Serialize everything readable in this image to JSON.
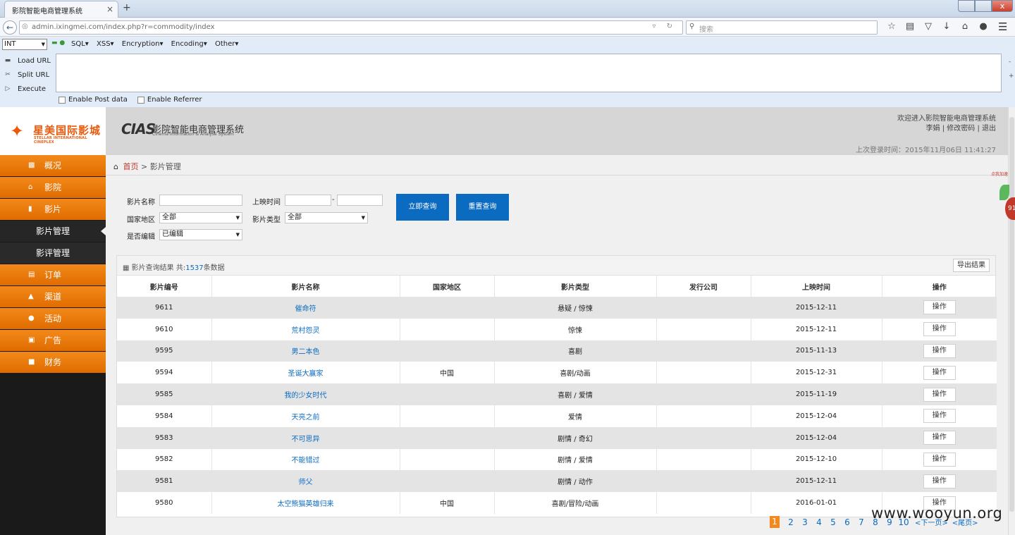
{
  "browser": {
    "tab_title": "影院智能电商管理系统",
    "tab_close": "×",
    "new_tab": "+",
    "url": "admin.ixingmei.com/index.php?r=commodity/index",
    "search_placeholder": "搜索",
    "window_close": "x"
  },
  "hackbar": {
    "type_select": "INT",
    "menus": [
      "SQL▾",
      "XSS▾",
      "Encryption▾",
      "Encoding▾",
      "Other▾"
    ],
    "actions": [
      "Load URL",
      "Split URL",
      "Execute"
    ],
    "checkbox_post": "Enable Post data",
    "checkbox_referrer": "Enable Referrer"
  },
  "header": {
    "logo_cn": "星美国际影城",
    "logo_en": "STELLAR INTERNATIONAL CINEPLEX",
    "brand_mark": "CIAS",
    "brand_title": "影院智能电商管理系统",
    "brand_sub": "Cinema Information & Analyse System",
    "welcome": "欢迎进入影院智能电商管理系统",
    "user_links": "李娟 | 修改密码 | 退出",
    "last_login": "上次登录时间：2015年11月06日 11:41:27"
  },
  "sidebar": {
    "items": [
      {
        "label": "概况",
        "icon": "chart-icon"
      },
      {
        "label": "影院",
        "icon": "home-icon"
      },
      {
        "label": "影片",
        "icon": "film-icon"
      }
    ],
    "sub_items": [
      {
        "label": "影片管理",
        "active": true
      },
      {
        "label": "影评管理",
        "active": false
      }
    ],
    "more_items": [
      {
        "label": "订单",
        "icon": "order-icon"
      },
      {
        "label": "渠道",
        "icon": "channel-icon"
      },
      {
        "label": "活动",
        "icon": "activity-icon"
      },
      {
        "label": "广告",
        "icon": "ad-icon"
      },
      {
        "label": "财务",
        "icon": "finance-icon"
      }
    ]
  },
  "breadcrumb": {
    "home": "首页",
    "separator": ">",
    "current": "影片管理"
  },
  "filters": {
    "name_label": "影片名称",
    "release_label": "上映时间",
    "dash": "-",
    "region_label": "国家地区",
    "region_value": "全部",
    "type_label": "影片类型",
    "type_value": "全部",
    "edited_label": "是否编辑",
    "edited_value": "已编辑",
    "query_button": "立即查询",
    "reset_button": "重置查询"
  },
  "results": {
    "title": "影片查询结果",
    "count_prefix": "共:",
    "count": "1537",
    "count_suffix": "条数据",
    "export_button": "导出结果",
    "columns": [
      "影片编号",
      "影片名称",
      "国家地区",
      "影片类型",
      "发行公司",
      "上映时间",
      "操作"
    ],
    "rows": [
      {
        "id": "9611",
        "name": "催命符",
        "region": "",
        "type": "悬疑 / 惊悚",
        "company": "",
        "date": "2015-12-11",
        "op": "操作"
      },
      {
        "id": "9610",
        "name": "荒村怨灵",
        "region": "",
        "type": "惊悚",
        "company": "",
        "date": "2015-12-11",
        "op": "操作"
      },
      {
        "id": "9595",
        "name": "男二本色",
        "region": "",
        "type": "喜剧",
        "company": "",
        "date": "2015-11-13",
        "op": "操作"
      },
      {
        "id": "9594",
        "name": "圣诞大赢家",
        "region": "中国",
        "type": "喜剧/动画",
        "company": "",
        "date": "2015-12-31",
        "op": "操作"
      },
      {
        "id": "9585",
        "name": "我的少女时代",
        "region": "",
        "type": "喜剧 / 爱情",
        "company": "",
        "date": "2015-11-19",
        "op": "操作"
      },
      {
        "id": "9584",
        "name": "天亮之前",
        "region": "",
        "type": "爱情",
        "company": "",
        "date": "2015-12-04",
        "op": "操作"
      },
      {
        "id": "9583",
        "name": "不可思异",
        "region": "",
        "type": "剧情 / 奇幻",
        "company": "",
        "date": "2015-12-04",
        "op": "操作"
      },
      {
        "id": "9582",
        "name": "不能错过",
        "region": "",
        "type": "剧情 / 爱情",
        "company": "",
        "date": "2015-12-10",
        "op": "操作"
      },
      {
        "id": "9581",
        "name": "师父",
        "region": "",
        "type": "剧情 / 动作",
        "company": "",
        "date": "2015-12-11",
        "op": "操作"
      },
      {
        "id": "9580",
        "name": "太空熊猫英雄归来",
        "region": "中国",
        "type": "喜剧/冒险/动画",
        "company": "",
        "date": "2016-01-01",
        "op": "操作"
      }
    ]
  },
  "pagination": {
    "current": "1",
    "pages": [
      "2",
      "3",
      "4",
      "5",
      "6",
      "7",
      "8",
      "9",
      "10"
    ],
    "next": "<下一页>",
    "last": "<尾页>"
  },
  "float_widget": {
    "label": "点我加速",
    "badge": "91"
  },
  "watermark": "www.wooyun.org",
  "colors": {
    "accent_orange": "#f3891a",
    "primary_blue": "#0b6bc1",
    "link_red": "#c0392b"
  }
}
